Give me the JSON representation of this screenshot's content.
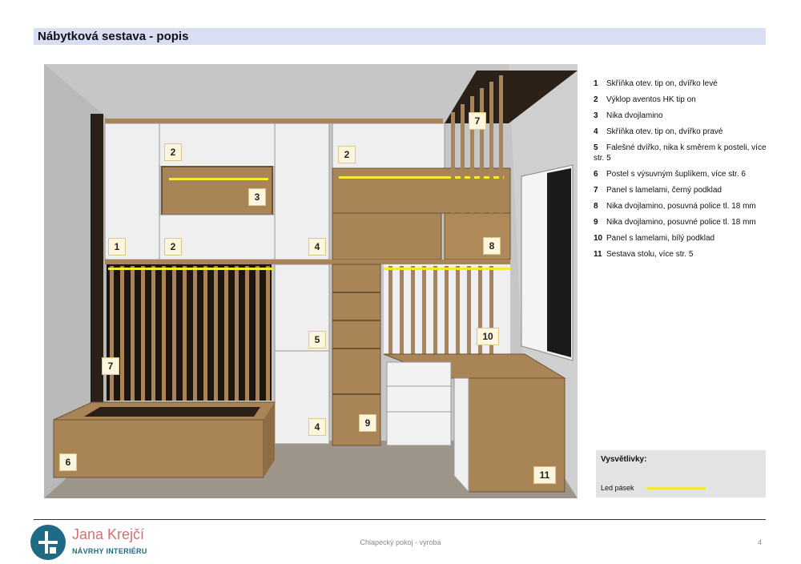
{
  "page_title": "Nábytková sestava - popis",
  "render_labels": [
    {
      "key": "1",
      "text": "1"
    },
    {
      "key": "2a",
      "text": "2"
    },
    {
      "key": "2b",
      "text": "2"
    },
    {
      "key": "2c",
      "text": "2"
    },
    {
      "key": "3",
      "text": "3"
    },
    {
      "key": "4a",
      "text": "4"
    },
    {
      "key": "4b",
      "text": "4"
    },
    {
      "key": "5",
      "text": "5"
    },
    {
      "key": "6",
      "text": "6"
    },
    {
      "key": "7a",
      "text": "7"
    },
    {
      "key": "7b",
      "text": "7"
    },
    {
      "key": "8",
      "text": "8"
    },
    {
      "key": "9",
      "text": "9"
    },
    {
      "key": "10",
      "text": "10"
    },
    {
      "key": "11",
      "text": "11"
    }
  ],
  "legend": [
    {
      "num": "1",
      "text": "Skříňka otev. tip on, dvířko levé"
    },
    {
      "num": "2",
      "text": "Výklop aventos HK tip on"
    },
    {
      "num": "3",
      "text": "Nika dvojlamino"
    },
    {
      "num": "4",
      "text": "Skříňka otev. tip on, dvířko pravé"
    },
    {
      "num": "5",
      "text": "Falešné dvířko, nika k směrem k posteli, více str. 5"
    },
    {
      "num": "6",
      "text": "Postel s výsuvným šuplíkem, více str. 6"
    },
    {
      "num": "7",
      "text": "Panel s lamelami, černý podklad"
    },
    {
      "num": "8",
      "text": "Nika dvojlamino, posuvná police tl. 18 mm"
    },
    {
      "num": "9",
      "text": "Nika dvojlamino, posuvné police tl. 18 mm"
    },
    {
      "num": "10",
      "text": "Panel s lamelami, bílý podklad"
    },
    {
      "num": "11",
      "text": "Sestava stolu, více str. 5"
    }
  ],
  "key_box": {
    "title": "Vysvětlivky:",
    "led_label": "Led pásek",
    "led_color": "#f3ea3a"
  },
  "logo": {
    "name": "Jana Krejčí",
    "subtitle": "NÁVRHY INTERIÉRU",
    "brand_color": "#1f6a84",
    "name_color": "#d66f6f"
  },
  "footer": {
    "center": "Chlapecký pokoj - výroba",
    "page_number": "4"
  },
  "colors": {
    "title_bar": "#d9def5",
    "wood": "#a88457",
    "cabinet_white": "#efefef",
    "dark_panel": "#2a2018"
  }
}
